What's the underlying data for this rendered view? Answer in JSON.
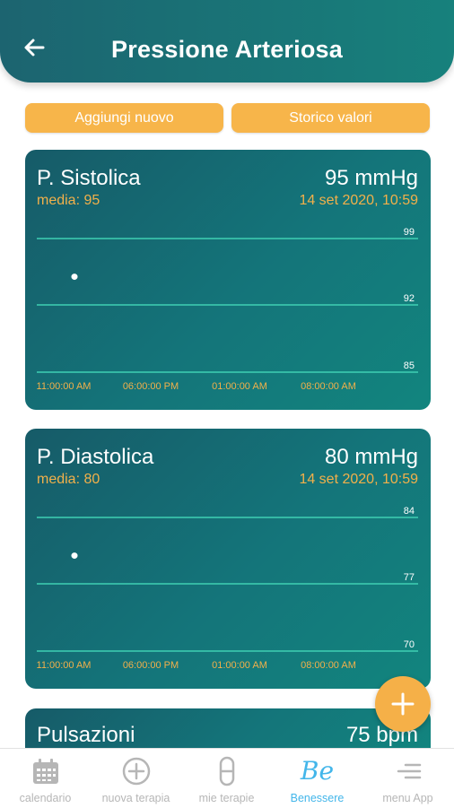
{
  "header": {
    "title": "Pressione Arteriosa"
  },
  "actions": {
    "add_new": "Aggiungi nuovo",
    "history": "Storico valori"
  },
  "colors": {
    "accent": "#f7b54a",
    "teal_dark": "#165b68",
    "teal_light": "#12857e",
    "active_tab": "#43b6ea"
  },
  "cards": [
    {
      "name": "P. Sistolica",
      "value": "95 mmHg",
      "average": "media: 95",
      "date": "14 set 2020, 10:59",
      "chart_data": {
        "type": "scatter",
        "y_ticks": [
          "99",
          "92",
          "85"
        ],
        "ylim": [
          85,
          99
        ],
        "x_ticks": [
          "11:00:00 AM",
          "06:00:00 PM",
          "01:00:00 AM",
          "08:00:00 AM"
        ],
        "points": [
          {
            "x": "14 set 2020, 10:59",
            "y": 95
          }
        ]
      }
    },
    {
      "name": "P. Diastolica",
      "value": "80 mmHg",
      "average": "media: 80",
      "date": "14 set 2020, 10:59",
      "chart_data": {
        "type": "scatter",
        "y_ticks": [
          "84",
          "77",
          "70"
        ],
        "ylim": [
          70,
          84
        ],
        "x_ticks": [
          "11:00:00 AM",
          "06:00:00 PM",
          "01:00:00 AM",
          "08:00:00 AM"
        ],
        "points": [
          {
            "x": "14 set 2020, 10:59",
            "y": 80
          }
        ]
      }
    },
    {
      "name": "Pulsazioni",
      "value": "75 bpm"
    }
  ],
  "tabbar": {
    "items": [
      {
        "label": "calendario",
        "icon": "calendar-icon"
      },
      {
        "label": "nuova terapia",
        "icon": "plus-circle-icon"
      },
      {
        "label": "mie terapie",
        "icon": "pill-icon"
      },
      {
        "label": "Benessere",
        "icon": "be-logo-icon",
        "active": true
      },
      {
        "label": "menu App",
        "icon": "menu-icon"
      }
    ]
  }
}
